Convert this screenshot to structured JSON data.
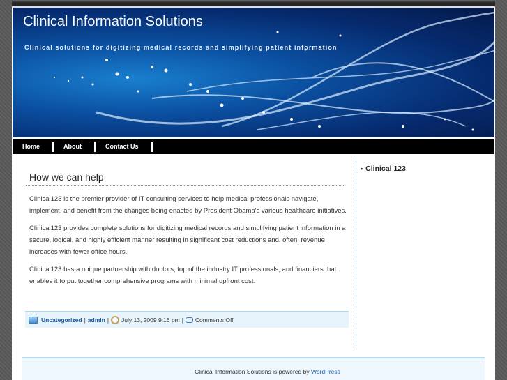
{
  "header": {
    "title": "Clinical Information Solutions",
    "tagline": "Clinical solutions for digitizing medical records and simplifying patient information"
  },
  "nav": [
    {
      "label": "Home"
    },
    {
      "label": "About"
    },
    {
      "label": "Contact Us"
    }
  ],
  "post": {
    "title": "How we can help",
    "paragraphs": [
      "Clinical123 is the premier provider of IT consulting services to help medical professionals navigate, implement, and benefit from the changes being enacted by President Obama's various healthcare initiatives.",
      "Clinical123 provides complete solutions for digitizing medical records and simplifying patient information in a secure, logical, and highly efficient manner resulting in significant cost reductions and, often, revenue increases with fewer office hours.",
      "Clinical123 has a unique partnership with doctors, top of the industry IT professionals, and financiers that enables it to put together comprehensive programs with minimal upfront cost."
    ],
    "meta": {
      "category": "Uncategorized",
      "author": "admin",
      "date": "July 13, 2009 9:16 pm",
      "comments": "Comments Off",
      "sep": "|"
    }
  },
  "sidebar": {
    "items": [
      {
        "label": "Clinical 123"
      }
    ]
  },
  "footer": {
    "text": "Clinical Information Solutions is powered by",
    "link": "WordPress"
  }
}
